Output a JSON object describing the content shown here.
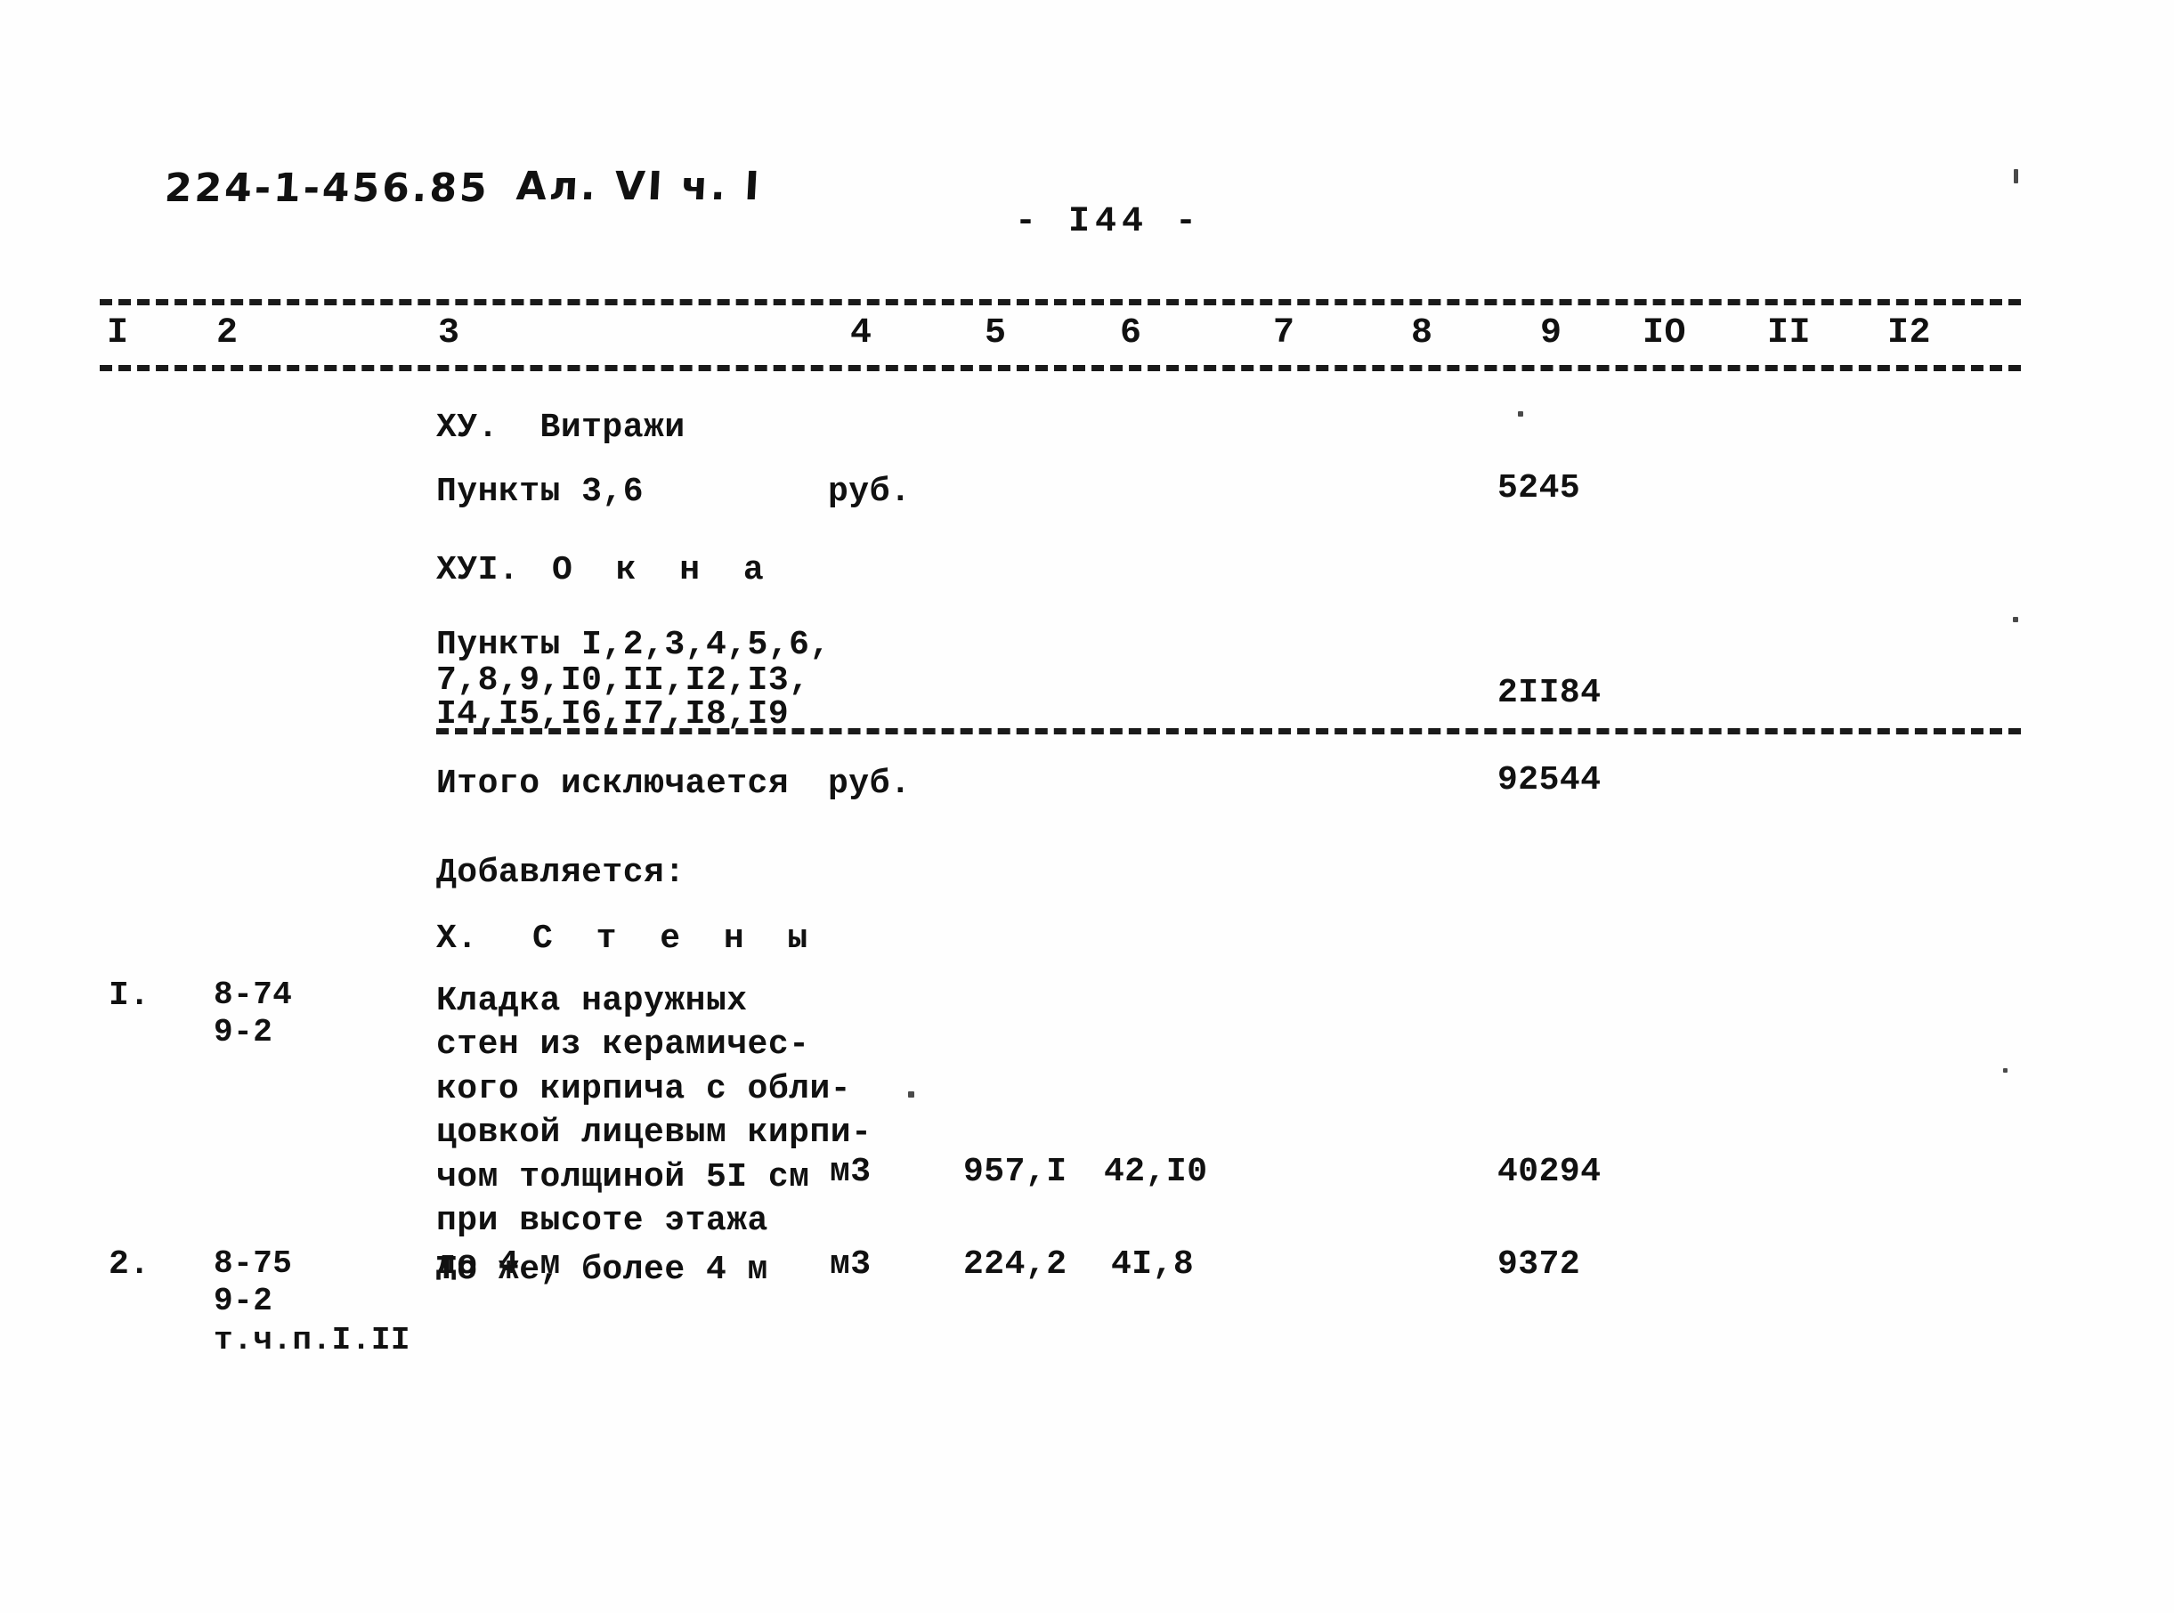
{
  "document": {
    "doc_code": "224-1-456.85",
    "album": "Ал. VI ч. I",
    "page_label": "- I44 -"
  },
  "table": {
    "column_headers": [
      "I",
      "2",
      "3",
      "4",
      "5",
      "6",
      "7",
      "8",
      "9",
      "IO",
      "II",
      "I2"
    ],
    "sections": [
      {
        "heading": "ХУ.  Витражи",
        "rows": [
          {
            "col3": "Пункты 3,6",
            "col4": "руб.",
            "col9": "5245"
          }
        ]
      },
      {
        "heading": "ХУI.  О к н а",
        "rows": [
          {
            "col3_line1": "Пункты I,2,3,4,5,6,",
            "col3_line2": "7,8,9,I0,II,I2,I3,",
            "col3_line3": "I4,I5,I6,I7,I8,I9",
            "col9": "2II84"
          }
        ]
      }
    ],
    "total_row": {
      "label": "Итого исключается",
      "unit": "руб.",
      "value": "92544"
    },
    "added_label": "Добавляется:",
    "added_section_heading": "Х.  С т е н ы",
    "added_rows": [
      {
        "num": "I.",
        "codes": [
          "8-74",
          "9-2"
        ],
        "description": "Кладка наружных\nстен из керамичес-\nкого кирпича с обли-\nцовкой лицевым кирпи-\nчом толщиной 5I см\nпри высоте этажа\nдо 4 м",
        "unit": "м3",
        "quantity": "957,I",
        "price": "42,I0",
        "total": "40294"
      },
      {
        "num": "2.",
        "codes": [
          "8-75",
          "9-2",
          "т.ч.п.I.II"
        ],
        "description": "То же, более 4 м",
        "unit": "м3",
        "quantity": "224,2",
        "price": "4I,8",
        "total": "9372"
      }
    ]
  }
}
